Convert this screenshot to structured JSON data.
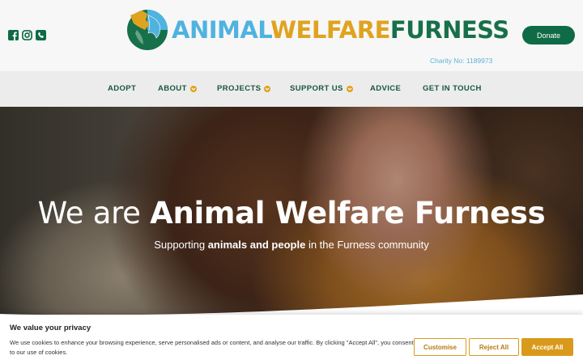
{
  "header": {
    "social": [
      {
        "icon": "facebook-icon"
      },
      {
        "icon": "instagram-icon"
      },
      {
        "icon": "phone-icon"
      }
    ],
    "logo": {
      "word1": "ANIMAL",
      "word2": "WELFARE",
      "word3": "FURNESS"
    },
    "donate_label": "Donate",
    "charity_text": "Charity No: 1189973"
  },
  "nav": {
    "items": [
      {
        "label": "ADOPT",
        "has_dropdown": false
      },
      {
        "label": "ABOUT",
        "has_dropdown": true
      },
      {
        "label": "PROJECTS",
        "has_dropdown": true
      },
      {
        "label": "SUPPORT US",
        "has_dropdown": true
      },
      {
        "label": "ADVICE",
        "has_dropdown": false
      },
      {
        "label": "GET IN TOUCH",
        "has_dropdown": false
      }
    ]
  },
  "hero": {
    "title_prefix": "We are ",
    "title_bold": "Animal Welfare Furness",
    "sub_prefix": "Supporting ",
    "sub_bold": "animals and people",
    "sub_suffix": " in the Furness community"
  },
  "cookie": {
    "title": "We value your privacy",
    "text": "We use cookies to enhance your browsing experience, serve personalised ads or content, and analyse our traffic. By clicking \"Accept All\", you consent to our use of cookies.",
    "customise_label": "Customise",
    "reject_label": "Reject All",
    "accept_label": "Accept All"
  },
  "colors": {
    "brand_green": "#0f6b45",
    "brand_blue": "#4fb3e0",
    "brand_gold": "#e0a31f"
  }
}
